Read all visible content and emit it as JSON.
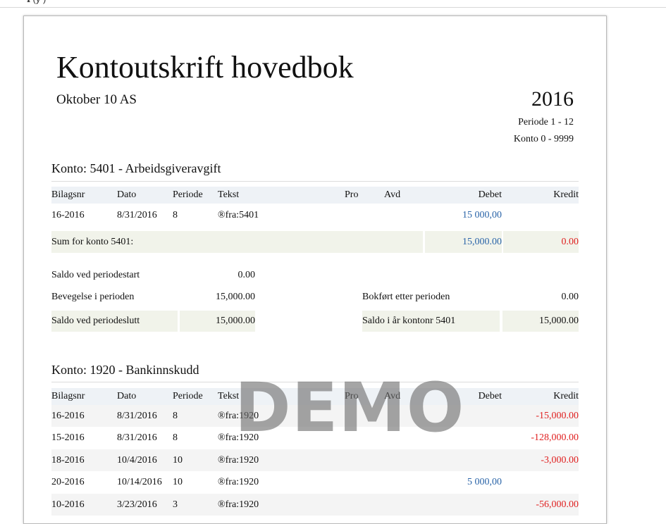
{
  "report": {
    "title": "Kontoutskrift hovedbok",
    "company": "Oktober 10 AS",
    "year": "2016",
    "periode": "Periode 1 - 12",
    "konto_range": "Konto 0 - 9999"
  },
  "columns": {
    "bilagsnr": "Bilagsnr",
    "dato": "Dato",
    "periode": "Periode",
    "tekst": "Tekst",
    "pro": "Pro",
    "avd": "Avd",
    "debet": "Debet",
    "kredit": "Kredit"
  },
  "accounts": [
    {
      "title": "Konto: 5401 - Arbeidsgiveravgift",
      "rows": [
        {
          "bilagsnr": "16-2016",
          "dato": "8/31/2016",
          "periode": "8",
          "tekst": "®fra:5401",
          "debet": "15 000,00",
          "kredit": ""
        }
      ],
      "sum_label": "Sum for konto 5401:",
      "sum_debet": "15,000.00",
      "sum_kredit": "0.00",
      "balance": {
        "saldo_start_label": "Saldo ved periodestart",
        "saldo_start_value": "0.00",
        "bevegelse_label": "Bevegelse i perioden",
        "bevegelse_value": "15,000.00",
        "bokfort_label": "Bokført etter perioden",
        "bokfort_value": "0.00",
        "saldo_slutt_label": "Saldo ved periodeslutt",
        "saldo_slutt_value": "15,000.00",
        "saldo_aar_label": "Saldo i år kontonr 5401",
        "saldo_aar_value": "15,000.00"
      }
    },
    {
      "title": "Konto: 1920 - Bankinnskudd",
      "rows": [
        {
          "bilagsnr": "16-2016",
          "dato": "8/31/2016",
          "periode": "8",
          "tekst": "®fra:1920",
          "debet": "",
          "kredit": "-15,000.00"
        },
        {
          "bilagsnr": "15-2016",
          "dato": "8/31/2016",
          "periode": "8",
          "tekst": "®fra:1920",
          "debet": "",
          "kredit": "-128,000.00"
        },
        {
          "bilagsnr": "18-2016",
          "dato": "10/4/2016",
          "periode": "10",
          "tekst": "®fra:1920",
          "debet": "",
          "kredit": "-3,000.00"
        },
        {
          "bilagsnr": "20-2016",
          "dato": "10/14/2016",
          "periode": "10",
          "tekst": "®fra:1920",
          "debet": "5 000,00",
          "kredit": ""
        },
        {
          "bilagsnr": "10-2016",
          "dato": "3/23/2016",
          "periode": "3",
          "tekst": "®fra:1920",
          "debet": "",
          "kredit": "-56,000.00"
        }
      ]
    }
  ],
  "watermark": "DEMO"
}
